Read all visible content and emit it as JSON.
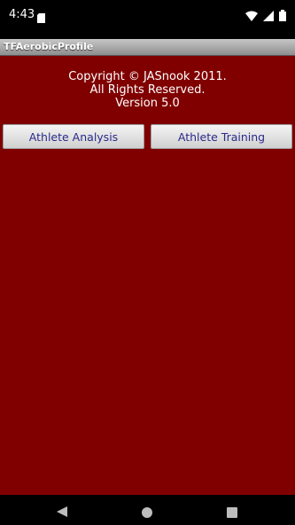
{
  "status": {
    "time": "4:43",
    "icons": [
      "sd-card-icon",
      "wifi-icon",
      "signal-icon",
      "battery-icon"
    ]
  },
  "app": {
    "title": "TFAerobicProfile"
  },
  "copyright": {
    "line1": "Copyright © JASnook 2011.",
    "line2": "All Rights Reserved.",
    "line3": "Version 5.0"
  },
  "buttons": {
    "analysis": "Athlete Analysis",
    "training": "Athlete Training"
  },
  "colors": {
    "background": "#800000",
    "button_text": "#2a2a8c"
  },
  "nav": {
    "icons": [
      "back-icon",
      "home-icon",
      "recent-apps-icon"
    ]
  }
}
